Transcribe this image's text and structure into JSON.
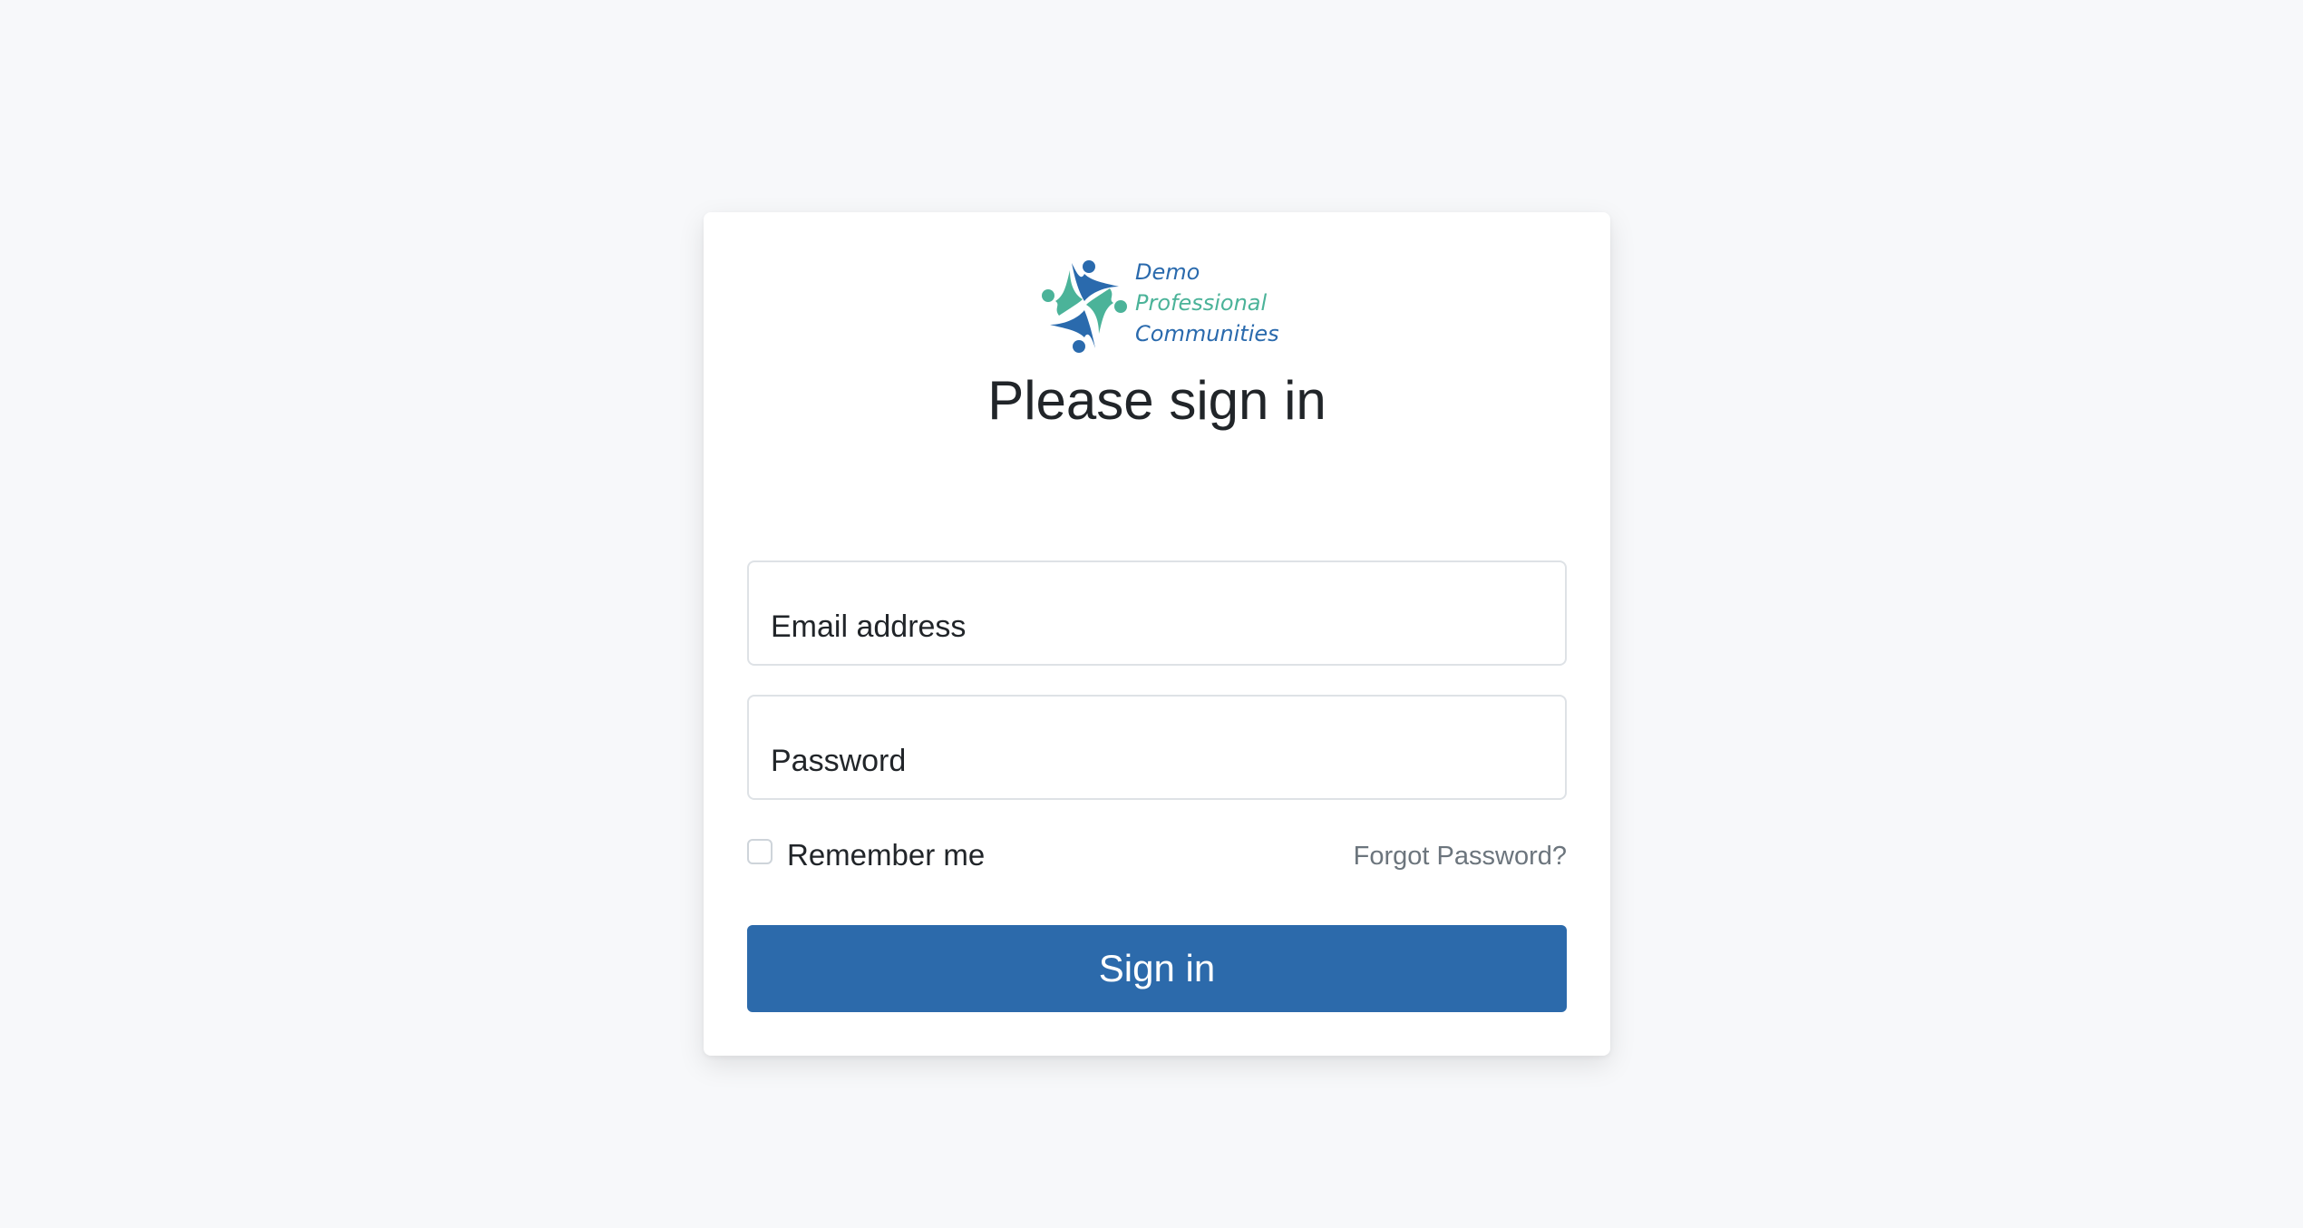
{
  "logo": {
    "line1": "Demo",
    "line2": "Professional",
    "line3": "Communities",
    "colors": {
      "blue": "#2a6aad",
      "teal": "#4bb399"
    }
  },
  "form": {
    "title": "Please sign in",
    "email_placeholder": "Email address",
    "password_placeholder": "Password",
    "remember_label": "Remember me",
    "remember_checked": false,
    "forgot_label": "Forgot Password?",
    "submit_label": "Sign in"
  },
  "colors": {
    "background": "#f7f8fa",
    "button": "#2c6aab",
    "link": "#6c757d"
  }
}
